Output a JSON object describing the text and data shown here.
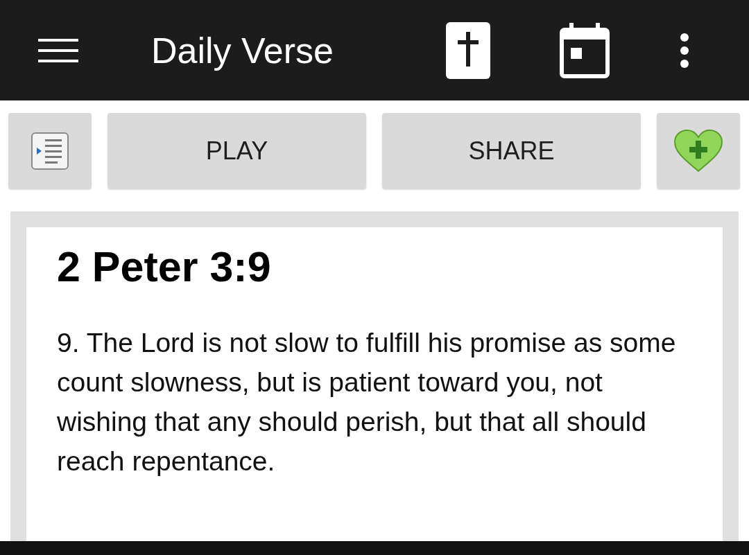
{
  "app_bar": {
    "title": "Daily Verse"
  },
  "buttons": [
    {
      "kind": "icon"
    },
    {
      "kind": "text",
      "label": "PLAY"
    },
    {
      "kind": "text",
      "label": "SHARE"
    },
    {
      "kind": "favorite"
    }
  ],
  "verse": {
    "reference": "2 Peter 3:9",
    "text": "9. The Lord is not slow to fulfill his promise as some count slowness, but is patient toward you, not wishing that any should perish, but that all should reach repentance."
  }
}
